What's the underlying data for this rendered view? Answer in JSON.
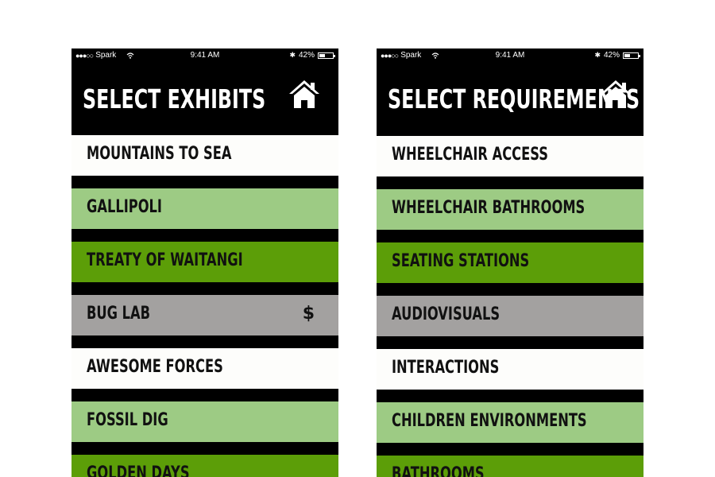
{
  "left_screen": {
    "status": {
      "carrier": "Spark",
      "time": "9:41 AM",
      "battery": "42%",
      "battery_level": 0.42
    },
    "title": "SELECT EXHIBITS",
    "items": [
      {
        "label": "MOUNTAINS TO SEA",
        "color": "#fdfdfb"
      },
      {
        "label": "GALLIPOLI",
        "color": "#9dcb84"
      },
      {
        "label": "TREATY OF WAITANGI",
        "color": "#5c9e08"
      },
      {
        "label": "BUG LAB",
        "badge": "$",
        "color": "#a3a1a0"
      },
      {
        "label": "AWESOME FORCES",
        "color": "#fdfdfb"
      },
      {
        "label": "FOSSIL DIG",
        "color": "#9dcb84"
      },
      {
        "label": "GOLDEN DAYS",
        "color": "#5c9e08"
      }
    ]
  },
  "right_screen": {
    "status": {
      "carrier": "Spark",
      "time": "9:41 AM",
      "battery": "42%",
      "battery_level": 0.42
    },
    "title": "SELECT REQUIREMENTS",
    "items": [
      {
        "label": "WHEELCHAIR ACCESS",
        "color": "#fdfdfb"
      },
      {
        "label": "WHEELCHAIR BATHROOMS",
        "color": "#9dcb84"
      },
      {
        "label": "SEATING STATIONS",
        "color": "#5c9e08"
      },
      {
        "label": "AUDIOVISUALS",
        "color": "#a3a1a0"
      },
      {
        "label": "INTERACTIONS",
        "color": "#fdfdfb"
      },
      {
        "label": "CHILDREN ENVIRONMENTS",
        "color": "#9dcb84"
      },
      {
        "label": "BATHROOMS",
        "color": "#5c9e08"
      }
    ]
  }
}
